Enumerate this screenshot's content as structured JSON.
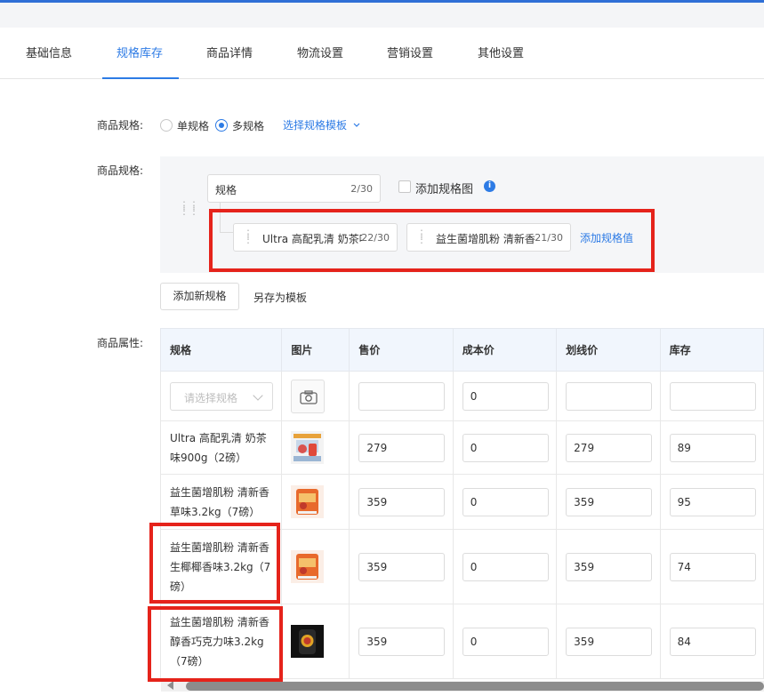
{
  "tabs": [
    {
      "label": "基础信息"
    },
    {
      "label": "规格库存"
    },
    {
      "label": "商品详情"
    },
    {
      "label": "物流设置"
    },
    {
      "label": "营销设置"
    },
    {
      "label": "其他设置"
    }
  ],
  "spec_type": {
    "label": "商品规格:",
    "options": [
      "单规格",
      "多规格"
    ],
    "selected": "多规格",
    "template_link": "选择规格模板"
  },
  "spec_editor": {
    "label": "商品规格:",
    "group_name": "规格",
    "group_count": "2/30",
    "add_image_label": "添加规格图",
    "values": [
      {
        "text": "Ultra 高配乳清 奶茶味",
        "count": "22/30"
      },
      {
        "text": "益生菌增肌粉 清新香",
        "count": "21/30"
      }
    ],
    "add_value_link": "添加规格值",
    "add_spec_button": "添加新规格",
    "save_template_button": "另存为模板"
  },
  "attributes": {
    "label": "商品属性:",
    "headers": [
      "规格",
      "图片",
      "售价",
      "成本价",
      "划线价",
      "库存"
    ],
    "batch_row": {
      "select_placeholder": "请选择规格",
      "price": "",
      "cost": "0",
      "list_price": "",
      "stock": ""
    },
    "rows": [
      {
        "spec": "Ultra 高配乳清 奶茶味900g（2磅）",
        "price": "279",
        "cost": "0",
        "list_price": "279",
        "stock": "89"
      },
      {
        "spec": "益生菌增肌粉 清新香草味3.2kg（7磅）",
        "price": "359",
        "cost": "0",
        "list_price": "359",
        "stock": "95"
      },
      {
        "spec": "益生菌增肌粉 清新香生椰椰香味3.2kg（7磅）",
        "price": "359",
        "cost": "0",
        "list_price": "359",
        "stock": "74"
      },
      {
        "spec": "益生菌增肌粉 清新香醇香巧克力味3.2kg（7磅）",
        "price": "359",
        "cost": "0",
        "list_price": "359",
        "stock": "84"
      }
    ]
  },
  "colors": {
    "accent": "#2d7be5",
    "highlight": "#e5231b",
    "table_header": "#f1f6fd"
  }
}
